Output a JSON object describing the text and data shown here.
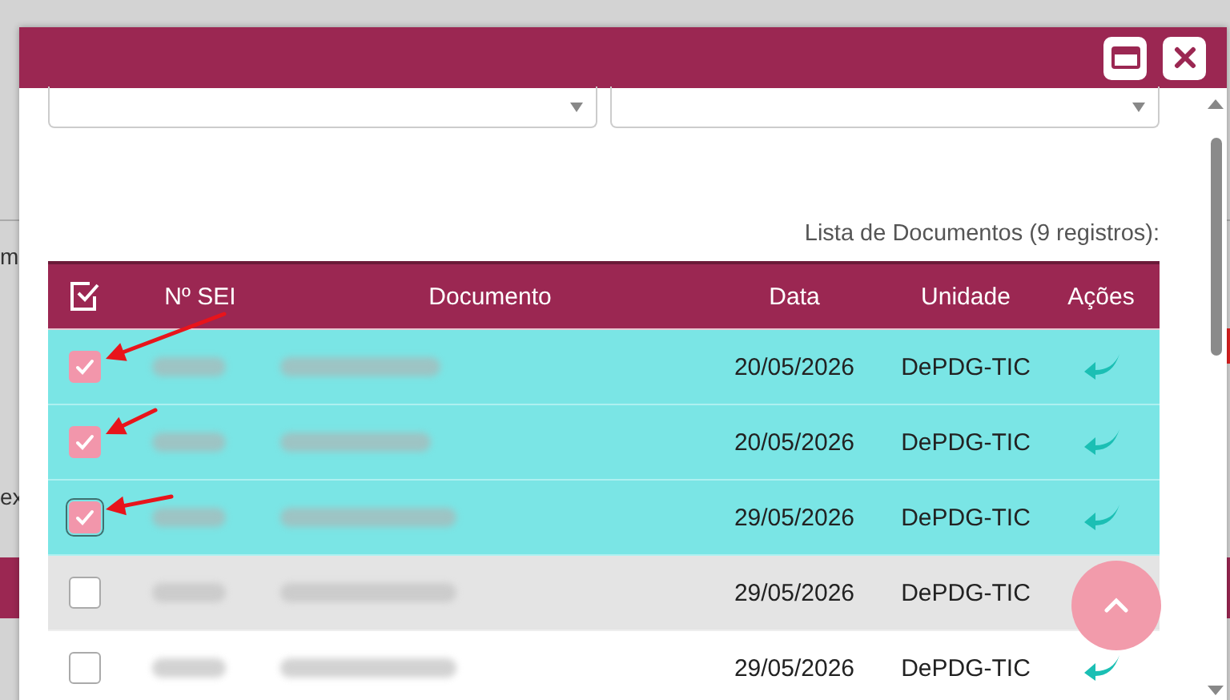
{
  "background": {
    "fragments": [
      {
        "text": "m",
        "kind": "top"
      },
      {
        "text": "ex",
        "kind": "bottom"
      }
    ]
  },
  "dialog": {
    "selects": [
      {
        "kind": "dropdown"
      },
      {
        "kind": "dropdown"
      }
    ],
    "caption": "Lista de Documentos (9 registros):",
    "table": {
      "select_all_checked": true,
      "columns": [
        "Nº SEI",
        "Documento",
        "Data",
        "Unidade",
        "Ações"
      ],
      "rows": [
        {
          "selected": true,
          "checked": true,
          "focused": false,
          "hovered": false,
          "annotated": true,
          "data": "20/05/2026",
          "unidade": "DePDG-TIC"
        },
        {
          "selected": true,
          "checked": true,
          "focused": false,
          "hovered": false,
          "annotated": true,
          "data": "20/05/2026",
          "unidade": "DePDG-TIC"
        },
        {
          "selected": true,
          "checked": true,
          "focused": true,
          "hovered": false,
          "annotated": true,
          "data": "29/05/2026",
          "unidade": "DePDG-TIC"
        },
        {
          "selected": false,
          "checked": false,
          "focused": false,
          "hovered": true,
          "annotated": false,
          "action_visible": false,
          "data": "29/05/2026",
          "unidade": "DePDG-TIC"
        },
        {
          "selected": false,
          "checked": false,
          "focused": false,
          "hovered": false,
          "annotated": false,
          "data": "29/05/2026",
          "unidade": "DePDG-TIC"
        }
      ]
    }
  }
}
